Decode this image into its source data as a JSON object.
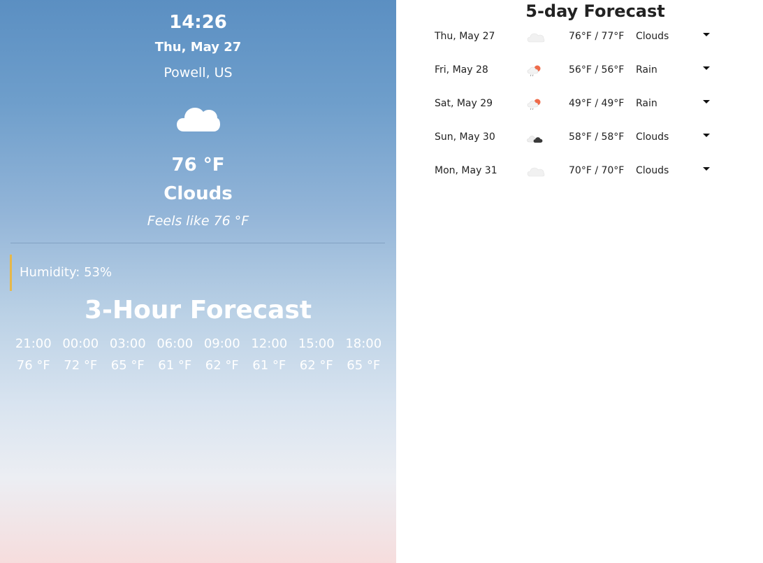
{
  "current": {
    "time": "14:26",
    "date": "Thu, May 27",
    "location": "Powell, US",
    "icon": "cloud-icon",
    "temperature": "76 °F",
    "condition": "Clouds",
    "feels_like": "Feels like 76 °F",
    "humidity": "Humidity: 53%"
  },
  "hourly": {
    "title": "3-Hour Forecast",
    "items": [
      {
        "time": "21:00",
        "temp": "76 °F"
      },
      {
        "time": "00:00",
        "temp": "72 °F"
      },
      {
        "time": "03:00",
        "temp": "65 °F"
      },
      {
        "time": "06:00",
        "temp": "61 °F"
      },
      {
        "time": "09:00",
        "temp": "62 °F"
      },
      {
        "time": "12:00",
        "temp": "61 °F"
      },
      {
        "time": "15:00",
        "temp": "62 °F"
      },
      {
        "time": "18:00",
        "temp": "65 °F"
      }
    ]
  },
  "daily": {
    "title": "5-day Forecast",
    "items": [
      {
        "date": "Thu, May 27",
        "icon": "cloud-icon",
        "temps": "76°F / 77°F",
        "condition": "Clouds"
      },
      {
        "date": "Fri, May 28",
        "icon": "rain-icon",
        "temps": "56°F / 56°F",
        "condition": "Rain"
      },
      {
        "date": "Sat, May 29",
        "icon": "rain-icon",
        "temps": "49°F / 49°F",
        "condition": "Rain"
      },
      {
        "date": "Sun, May 30",
        "icon": "broken-clouds-icon",
        "temps": "58°F / 58°F",
        "condition": "Clouds"
      },
      {
        "date": "Mon, May 31",
        "icon": "cloud-icon",
        "temps": "70°F / 70°F",
        "condition": "Clouds"
      }
    ]
  },
  "colors": {
    "sky_top": "#5b8fc2",
    "sky_bottom": "#f6dddd",
    "humidity_accent": "#e6b84a",
    "rain_sun": "#ef6b4a"
  }
}
